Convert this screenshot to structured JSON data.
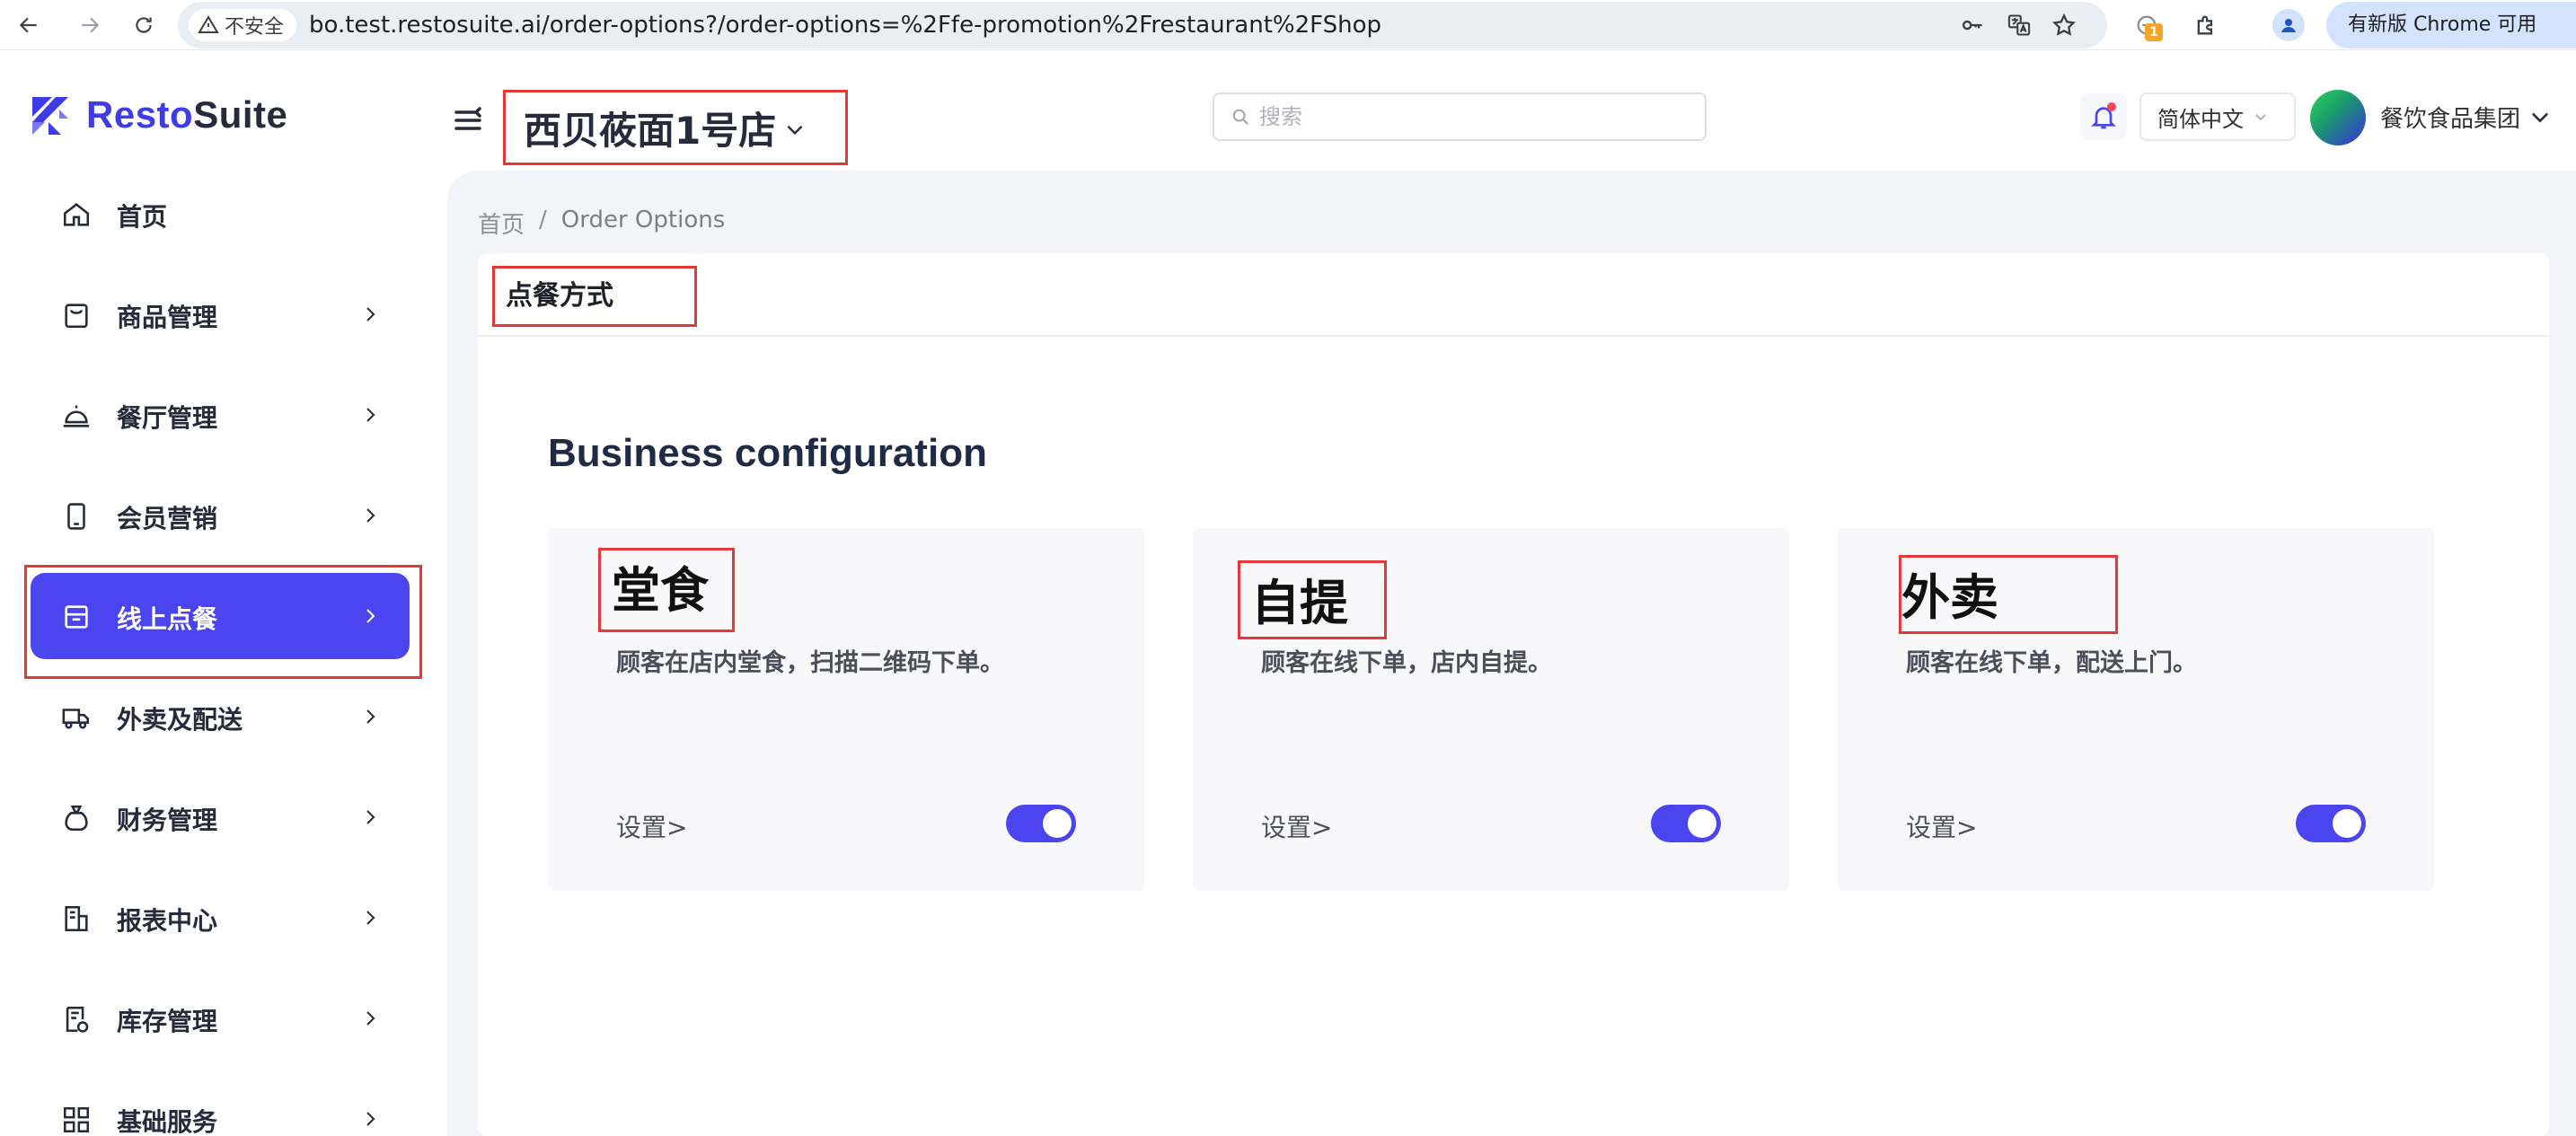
{
  "browser": {
    "insecure_label": "不安全",
    "url": "bo.test.restosuite.ai/order-options?/order-options=%2Ffe-promotion%2Frestaurant%2FShop",
    "extension_badge": "1",
    "update_label": "有新版 Chrome 可用"
  },
  "header": {
    "logo_resto": "Resto",
    "logo_suite": "Suite",
    "store_name": "西贝莜面1号店",
    "search_placeholder": "搜索",
    "language": "简体中文",
    "org_name": "餐饮食品集团"
  },
  "sidebar": {
    "items": [
      {
        "label": "首页",
        "icon": "home-icon",
        "has_arrow": false,
        "active": false
      },
      {
        "label": "商品管理",
        "icon": "bag-icon",
        "has_arrow": true,
        "active": false
      },
      {
        "label": "餐厅管理",
        "icon": "cloche-icon",
        "has_arrow": true,
        "active": false
      },
      {
        "label": "会员营销",
        "icon": "phone-icon",
        "has_arrow": true,
        "active": false
      },
      {
        "label": "线上点餐",
        "icon": "store-icon",
        "has_arrow": true,
        "active": true
      },
      {
        "label": "外卖及配送",
        "icon": "truck-icon",
        "has_arrow": true,
        "active": false
      },
      {
        "label": "财务管理",
        "icon": "money-bag-icon",
        "has_arrow": true,
        "active": false
      },
      {
        "label": "报表中心",
        "icon": "report-icon",
        "has_arrow": true,
        "active": false
      },
      {
        "label": "库存管理",
        "icon": "inventory-icon",
        "has_arrow": true,
        "active": false
      },
      {
        "label": "基础服务",
        "icon": "grid-icon",
        "has_arrow": true,
        "active": false
      }
    ]
  },
  "breadcrumb": {
    "home": "首页",
    "separator": "/",
    "current": "Order Options"
  },
  "page": {
    "title": "点餐方式",
    "section_heading": "Business configuration",
    "cards": [
      {
        "title": "堂食",
        "description": "顾客在店内堂食，扫描二维码下单。",
        "settings_label": "设置>",
        "enabled": true
      },
      {
        "title": "自提",
        "description": "顾客在线下单，店内自提。",
        "settings_label": "设置>",
        "enabled": true
      },
      {
        "title": "外卖",
        "description": "顾客在线下单，配送上门。",
        "settings_label": "设置>",
        "enabled": true
      }
    ]
  },
  "colors": {
    "brand": "#3d3ce6",
    "active_menu": "#4a45ee",
    "highlight_box": "#e53935",
    "toggle_on": "#4a45ee"
  }
}
